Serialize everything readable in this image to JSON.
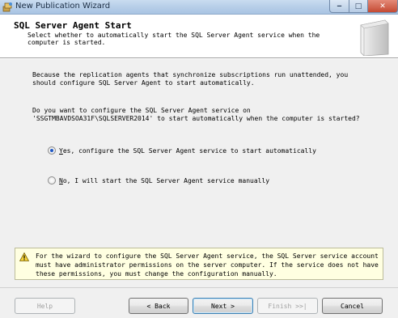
{
  "window": {
    "title": "New Publication Wizard",
    "minimize_glyph": "‒",
    "maximize_glyph": "□",
    "close_glyph": "✕"
  },
  "header": {
    "title": "SQL Server Agent Start",
    "subtitle": "Select whether to automatically start the SQL Server Agent service when the computer is started."
  },
  "content": {
    "explanation": "Because the replication agents that synchronize subscriptions run unattended, you should configure SQL Server Agent to start automatically.",
    "question_line1": "Do you want to configure the SQL Server Agent service on",
    "question_line2": "'SSGTMBAVDSOA31F\\SQLSERVER2014' to start automatically when the computer is started?",
    "options": [
      {
        "hotkey": "Y",
        "rest": "es, configure the SQL Server Agent service to start automatically",
        "selected": true
      },
      {
        "hotkey": "N",
        "rest": "o, I will start the SQL Server Agent service manually",
        "selected": false
      }
    ],
    "warning": "For the wizard to configure the SQL Server Agent service, the SQL Server service account must have administrator permissions on the server computer. If the service does not have these permissions, you must change the configuration manually."
  },
  "footer": {
    "help": "Help",
    "back": "< Back",
    "next": "Next >",
    "finish": "Finish >>|",
    "cancel": "Cancel"
  },
  "icons": {
    "app": "wizard-icon",
    "warning": "warning-icon",
    "header": "server-graphic"
  },
  "colors": {
    "radio_selected": "#1f58c4",
    "warning_background": "#ffffe1",
    "close_button": "#c44a33"
  }
}
